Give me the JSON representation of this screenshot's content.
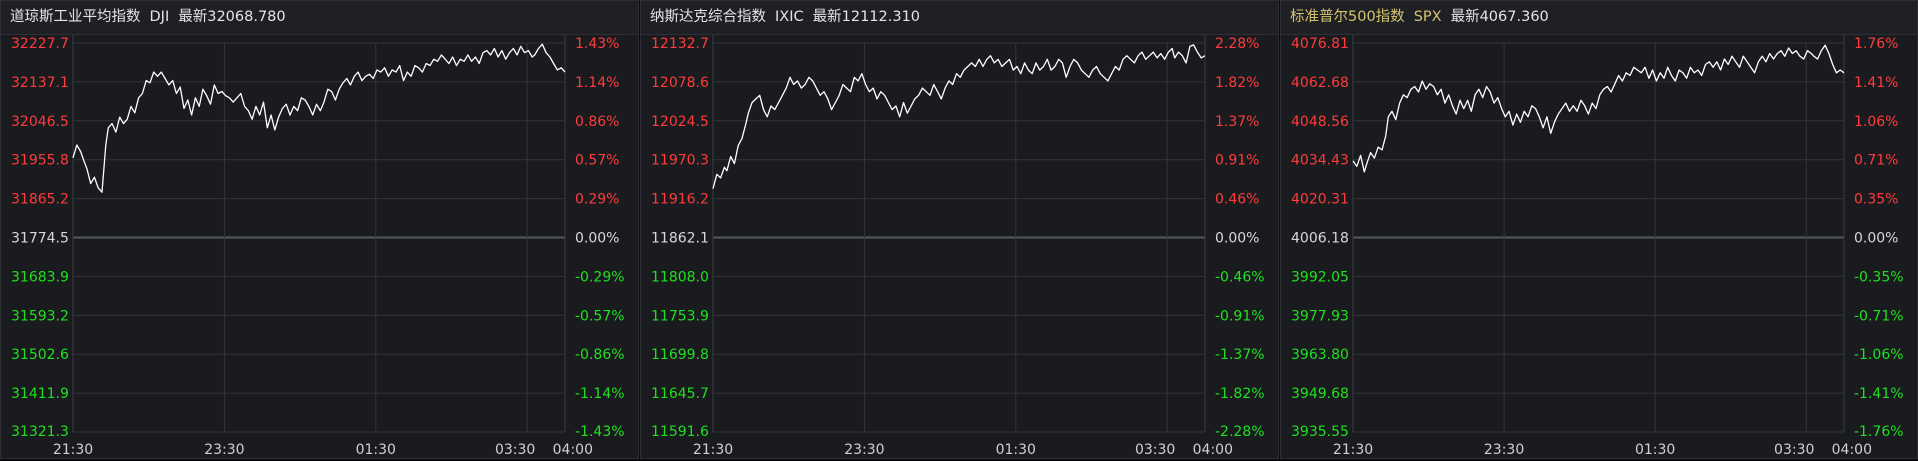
{
  "colors": {
    "up": "#ff3b3b",
    "down": "#1fe01f",
    "flat": "#d8d8d8",
    "line": "#ffffff",
    "grid": "#33353b",
    "title_highlight": "#d4c370"
  },
  "panels": [
    {
      "name": "道琼斯工业平均指数",
      "code": "DJI",
      "latest_text": "最新32068.780",
      "title_color": "#e4e4e4"
    },
    {
      "name": "纳斯达克综合指数",
      "code": "IXIC",
      "latest_text": "最新12112.310",
      "title_color": "#e4e4e4"
    },
    {
      "name": "标准普尔500指数",
      "code": "SPX",
      "latest_text": "最新4067.360",
      "title_color": "#d4c370"
    }
  ],
  "chart_data": [
    {
      "type": "line",
      "title": "道琼斯工业平均指数 DJI",
      "x_ticks": [
        "21:30",
        "23:30",
        "01:30",
        "03:30",
        "04:00"
      ],
      "x_tick_minutes": [
        0,
        120,
        240,
        360,
        390
      ],
      "x_range_minutes": [
        0,
        390
      ],
      "ylim": [
        31321.3,
        32227.7
      ],
      "prev_close": 31774.5,
      "y_ticks": [
        "32227.7",
        "32137.1",
        "32046.5",
        "31955.8",
        "31865.2",
        "31774.5",
        "31683.9",
        "31593.2",
        "31502.6",
        "31411.9",
        "31321.3"
      ],
      "pct_ticks": [
        "1.43%",
        "1.14%",
        "0.86%",
        "0.57%",
        "0.29%",
        "0.00%",
        "-0.29%",
        "-0.57%",
        "-0.86%",
        "-1.14%",
        "-1.43%"
      ],
      "grid": true,
      "series": [
        {
          "x": [
            0,
            3,
            6,
            9,
            11,
            14,
            17,
            20,
            23,
            26,
            28,
            31,
            34,
            37,
            40,
            43,
            46,
            49,
            52,
            55,
            58,
            61,
            64,
            67,
            70,
            73,
            76,
            79,
            82,
            85,
            88,
            91,
            94,
            97,
            100,
            103,
            106,
            109,
            112,
            115,
            118,
            121,
            124,
            127,
            130,
            133,
            136,
            139,
            142,
            145,
            148,
            151,
            154,
            157,
            160,
            163,
            166,
            169,
            172,
            175,
            178,
            181,
            184,
            187,
            190,
            193,
            196,
            199,
            202,
            205,
            208,
            211,
            214,
            217,
            220,
            223,
            226,
            229,
            232,
            235,
            238,
            241,
            244,
            247,
            250,
            253,
            256,
            259,
            262,
            265,
            268,
            271,
            274,
            277,
            280,
            283,
            286,
            289,
            292,
            295,
            298,
            301,
            304,
            307,
            310,
            313,
            316,
            319,
            322,
            325,
            328,
            331,
            334,
            337,
            340,
            343,
            346,
            349,
            352,
            355,
            358,
            361,
            364,
            366,
            369,
            372,
            375,
            378,
            381,
            384,
            387,
            390
          ],
          "y": [
            31960,
            31990,
            31975,
            31950,
            31935,
            31900,
            31915,
            31890,
            31880,
            31990,
            32030,
            32040,
            32020,
            32055,
            32040,
            32050,
            32080,
            32065,
            32100,
            32110,
            32140,
            32135,
            32160,
            32150,
            32160,
            32145,
            32130,
            32140,
            32110,
            32125,
            32075,
            32095,
            32060,
            32100,
            32080,
            32120,
            32105,
            32085,
            32130,
            32110,
            32115,
            32105,
            32100,
            32090,
            32100,
            32110,
            32080,
            32070,
            32050,
            32080,
            32060,
            32090,
            32030,
            32060,
            32025,
            32055,
            32075,
            32085,
            32060,
            32080,
            32070,
            32100,
            32095,
            32080,
            32060,
            32085,
            32070,
            32090,
            32120,
            32115,
            32095,
            32120,
            32135,
            32145,
            32130,
            32150,
            32160,
            32140,
            32150,
            32155,
            32145,
            32165,
            32160,
            32170,
            32150,
            32165,
            32160,
            32175,
            32140,
            32160,
            32150,
            32175,
            32170,
            32160,
            32180,
            32175,
            32190,
            32185,
            32200,
            32190,
            32180,
            32195,
            32175,
            32190,
            32185,
            32200,
            32185,
            32195,
            32180,
            32205,
            32210,
            32200,
            32215,
            32195,
            32210,
            32190,
            32205,
            32215,
            32200,
            32220,
            32205,
            32210,
            32195,
            32200,
            32215,
            32225,
            32205,
            32195,
            32180,
            32165,
            32170,
            32160
          ]
        }
      ]
    },
    {
      "type": "line",
      "title": "纳斯达克综合指数 IXIC",
      "x_ticks": [
        "21:30",
        "23:30",
        "01:30",
        "03:30",
        "04:00"
      ],
      "x_tick_minutes": [
        0,
        120,
        240,
        360,
        390
      ],
      "x_range_minutes": [
        0,
        390
      ],
      "ylim": [
        11591.6,
        12132.7
      ],
      "prev_close": 11862.1,
      "y_ticks": [
        "12132.7",
        "12078.6",
        "12024.5",
        "11970.3",
        "11916.2",
        "11862.1",
        "11808.0",
        "11753.9",
        "11699.8",
        "11645.7",
        "11591.6"
      ],
      "pct_ticks": [
        "2.28%",
        "1.82%",
        "1.37%",
        "0.91%",
        "0.46%",
        "0.00%",
        "-0.46%",
        "-0.91%",
        "-1.37%",
        "-1.82%",
        "-2.28%"
      ],
      "grid": true,
      "series": [
        {
          "x": [
            0,
            3,
            6,
            9,
            11,
            14,
            17,
            20,
            23,
            26,
            28,
            31,
            34,
            37,
            40,
            43,
            46,
            49,
            52,
            55,
            58,
            61,
            64,
            67,
            70,
            73,
            76,
            79,
            82,
            85,
            88,
            91,
            94,
            97,
            100,
            103,
            106,
            109,
            112,
            115,
            118,
            121,
            124,
            127,
            130,
            133,
            136,
            139,
            142,
            145,
            148,
            151,
            154,
            157,
            160,
            163,
            166,
            169,
            172,
            175,
            178,
            181,
            184,
            187,
            190,
            193,
            196,
            199,
            202,
            205,
            208,
            211,
            214,
            217,
            220,
            223,
            226,
            229,
            232,
            235,
            238,
            241,
            244,
            247,
            250,
            253,
            256,
            259,
            262,
            265,
            268,
            271,
            274,
            277,
            280,
            283,
            286,
            289,
            292,
            295,
            298,
            301,
            304,
            307,
            310,
            313,
            316,
            319,
            322,
            325,
            328,
            331,
            334,
            337,
            340,
            343,
            346,
            349,
            352,
            355,
            358,
            361,
            364,
            366,
            369,
            372,
            375,
            378,
            381,
            384,
            387,
            390
          ],
          "y": [
            11930,
            11950,
            11945,
            11960,
            11955,
            11975,
            11965,
            11990,
            12000,
            12020,
            12035,
            12050,
            12055,
            12060,
            12040,
            12030,
            12045,
            12040,
            12050,
            12060,
            12070,
            12085,
            12075,
            12080,
            12070,
            12075,
            12085,
            12080,
            12070,
            12060,
            12065,
            12055,
            12040,
            12050,
            12060,
            12075,
            12070,
            12065,
            12085,
            12080,
            12090,
            12075,
            12065,
            12070,
            12055,
            12065,
            12060,
            12050,
            12040,
            12045,
            12030,
            12050,
            12035,
            12045,
            12055,
            12060,
            12070,
            12065,
            12060,
            12075,
            12065,
            12055,
            12070,
            12080,
            12075,
            12090,
            12085,
            12095,
            12100,
            12105,
            12100,
            12110,
            12100,
            12110,
            12115,
            12105,
            12110,
            12100,
            12105,
            12110,
            12095,
            12100,
            12090,
            12105,
            12095,
            12090,
            12105,
            12095,
            12100,
            12110,
            12095,
            12100,
            12110,
            12105,
            12085,
            12100,
            12110,
            12105,
            12095,
            12090,
            12085,
            12095,
            12100,
            12090,
            12085,
            12080,
            12090,
            12100,
            12095,
            12110,
            12115,
            12110,
            12105,
            12115,
            12120,
            12110,
            12115,
            12120,
            12112,
            12118,
            12110,
            12120,
            12125,
            12112,
            12120,
            12115,
            12105,
            12128,
            12130,
            12120,
            12112,
            12115
          ]
        }
      ]
    },
    {
      "type": "line",
      "title": "标准普尔500指数 SPX",
      "x_ticks": [
        "21:30",
        "23:30",
        "01:30",
        "03:30",
        "04:00"
      ],
      "x_tick_minutes": [
        0,
        120,
        240,
        360,
        390
      ],
      "x_range_minutes": [
        0,
        390
      ],
      "ylim": [
        3935.55,
        4076.81
      ],
      "prev_close": 4006.18,
      "y_ticks": [
        "4076.81",
        "4062.68",
        "4048.56",
        "4034.43",
        "4020.31",
        "4006.18",
        "3992.05",
        "3977.93",
        "3963.80",
        "3949.68",
        "3935.55"
      ],
      "pct_ticks": [
        "1.76%",
        "1.41%",
        "1.06%",
        "0.71%",
        "0.35%",
        "0.00%",
        "-0.35%",
        "-0.71%",
        "-1.06%",
        "-1.41%",
        "-1.76%"
      ],
      "grid": true,
      "series": [
        {
          "x": [
            0,
            3,
            6,
            9,
            11,
            14,
            17,
            20,
            23,
            26,
            28,
            31,
            34,
            37,
            40,
            43,
            46,
            49,
            52,
            55,
            58,
            61,
            64,
            67,
            70,
            73,
            76,
            79,
            82,
            85,
            88,
            91,
            94,
            97,
            100,
            103,
            106,
            109,
            112,
            115,
            118,
            121,
            124,
            127,
            130,
            133,
            136,
            139,
            142,
            145,
            148,
            151,
            154,
            157,
            160,
            163,
            166,
            169,
            172,
            175,
            178,
            181,
            184,
            187,
            190,
            193,
            196,
            199,
            202,
            205,
            208,
            211,
            214,
            217,
            220,
            223,
            226,
            229,
            232,
            235,
            238,
            241,
            244,
            247,
            250,
            253,
            256,
            259,
            262,
            265,
            268,
            271,
            274,
            277,
            280,
            283,
            286,
            289,
            292,
            295,
            298,
            301,
            304,
            307,
            310,
            313,
            316,
            319,
            322,
            325,
            328,
            331,
            334,
            337,
            340,
            343,
            346,
            349,
            352,
            355,
            358,
            361,
            364,
            366,
            369,
            372,
            375,
            378,
            381,
            384,
            387,
            390
          ],
          "y": [
            4034,
            4032,
            4036,
            4030,
            4033,
            4037,
            4035,
            4039,
            4038,
            4043,
            4050,
            4052,
            4049,
            4055,
            4058,
            4057,
            4060,
            4061,
            4059,
            4063,
            4060,
            4062,
            4061,
            4058,
            4060,
            4055,
            4058,
            4054,
            4051,
            4056,
            4053,
            4056,
            4052,
            4058,
            4060,
            4057,
            4061,
            4059,
            4055,
            4057,
            4053,
            4050,
            4052,
            4047,
            4051,
            4048,
            4052,
            4050,
            4054,
            4053,
            4050,
            4046,
            4050,
            4044,
            4048,
            4051,
            4053,
            4055,
            4052,
            4054,
            4052,
            4056,
            4054,
            4051,
            4055,
            4053,
            4058,
            4060,
            4061,
            4059,
            4062,
            4065,
            4063,
            4066,
            4065,
            4068,
            4067,
            4066,
            4068,
            4064,
            4067,
            4063,
            4066,
            4064,
            4068,
            4065,
            4063,
            4067,
            4066,
            4064,
            4068,
            4066,
            4067,
            4065,
            4069,
            4070,
            4068,
            4070,
            4067,
            4071,
            4069,
            4072,
            4070,
            4068,
            4072,
            4070,
            4068,
            4066,
            4070,
            4072,
            4070,
            4073,
            4071,
            4073,
            4074,
            4072,
            4075,
            4073,
            4074,
            4072,
            4071,
            4074,
            4073,
            4072,
            4071,
            4074,
            4076,
            4073,
            4069,
            4066,
            4067,
            4066
          ]
        }
      ]
    }
  ]
}
